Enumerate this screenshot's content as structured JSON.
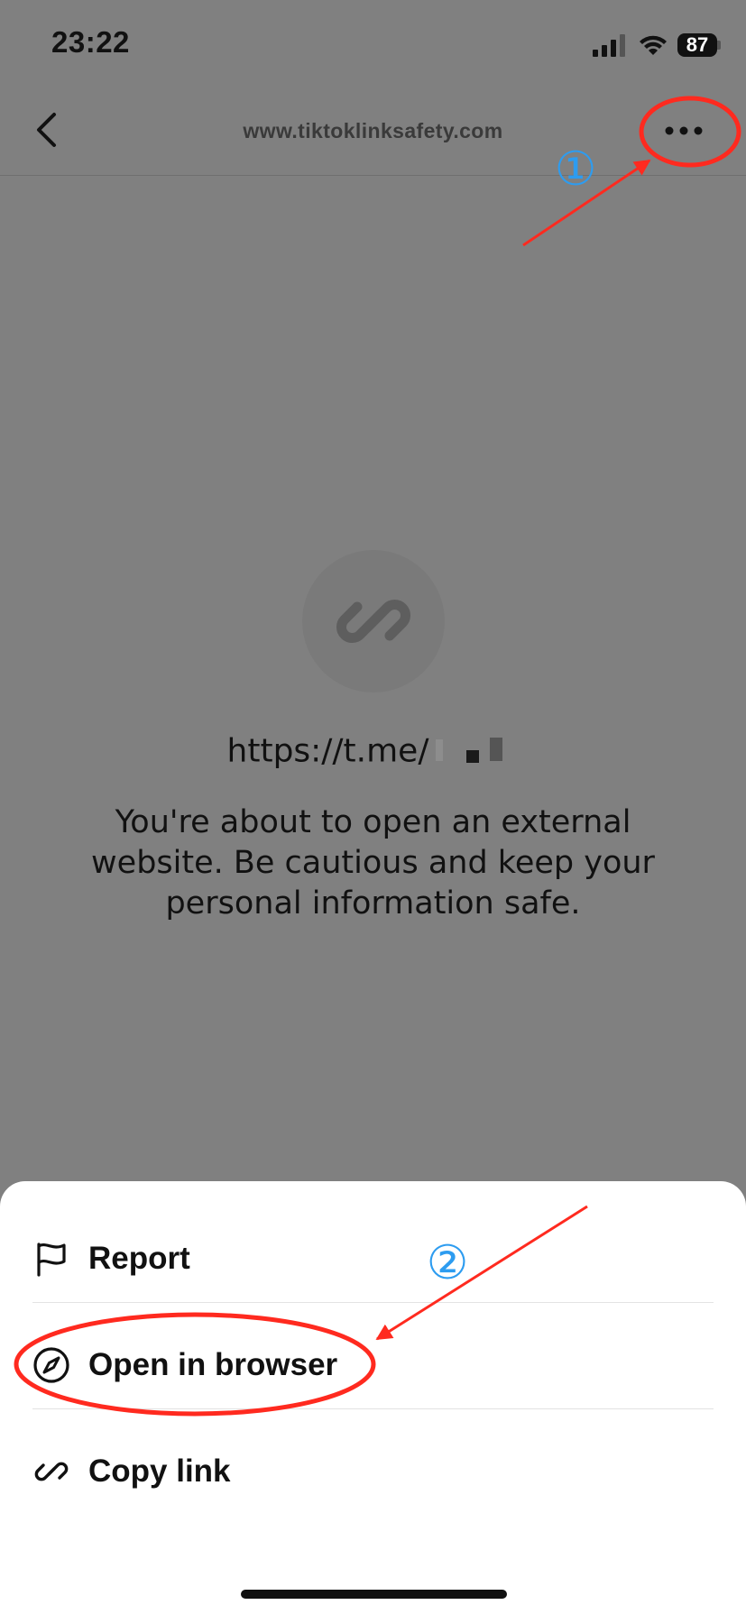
{
  "status_bar": {
    "time": "23:22",
    "battery": "87",
    "icons": [
      "signal-icon",
      "wifi-icon",
      "battery-icon"
    ]
  },
  "navbar": {
    "title": "www.tiktoklinksafety.com",
    "back_icon": "chevron-left-icon",
    "more_icon": "more-horizontal-icon"
  },
  "content": {
    "link_icon": "link-icon",
    "url": "https://t.me/",
    "warning": "You're about to open an external website. Be cautious and keep your personal information safe."
  },
  "menu": {
    "items": [
      {
        "label": "Report",
        "icon": "flag-icon"
      },
      {
        "label": "Open in browser",
        "icon": "compass-icon"
      },
      {
        "label": "Copy link",
        "icon": "link-icon"
      }
    ]
  },
  "annotations": {
    "step1": "①",
    "step2": "②",
    "color_circle": "#ff2a1f",
    "color_number": "#2d9cf0"
  }
}
